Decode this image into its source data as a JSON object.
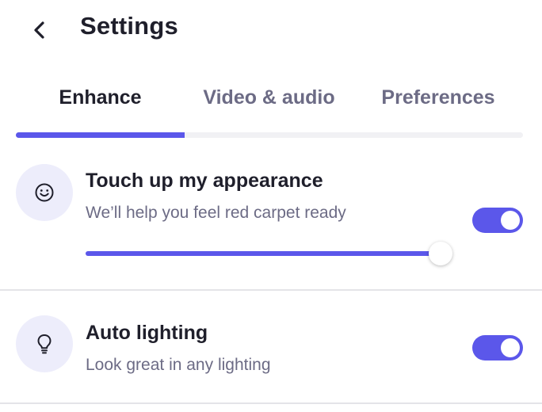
{
  "header": {
    "back_icon": "chevron-left-icon",
    "title": "Settings"
  },
  "tabs": [
    {
      "label": "Enhance",
      "active": true
    },
    {
      "label": "Video & audio",
      "active": false
    },
    {
      "label": "Preferences",
      "active": false
    }
  ],
  "settings": {
    "touch_up": {
      "icon": "smiley-face-icon",
      "title": "Touch up my appearance",
      "subtitle": "We’ll help you feel red carpet ready",
      "enabled": true,
      "level_percent": 100
    },
    "auto_lighting": {
      "icon": "lightbulb-icon",
      "title": "Auto lighting",
      "subtitle": "Look great in any lighting",
      "enabled": true
    }
  },
  "colors": {
    "accent": "#5b57ea",
    "icon_background": "#ededfb",
    "text_primary": "#1f1f2b",
    "text_secondary": "#6c6b85"
  }
}
